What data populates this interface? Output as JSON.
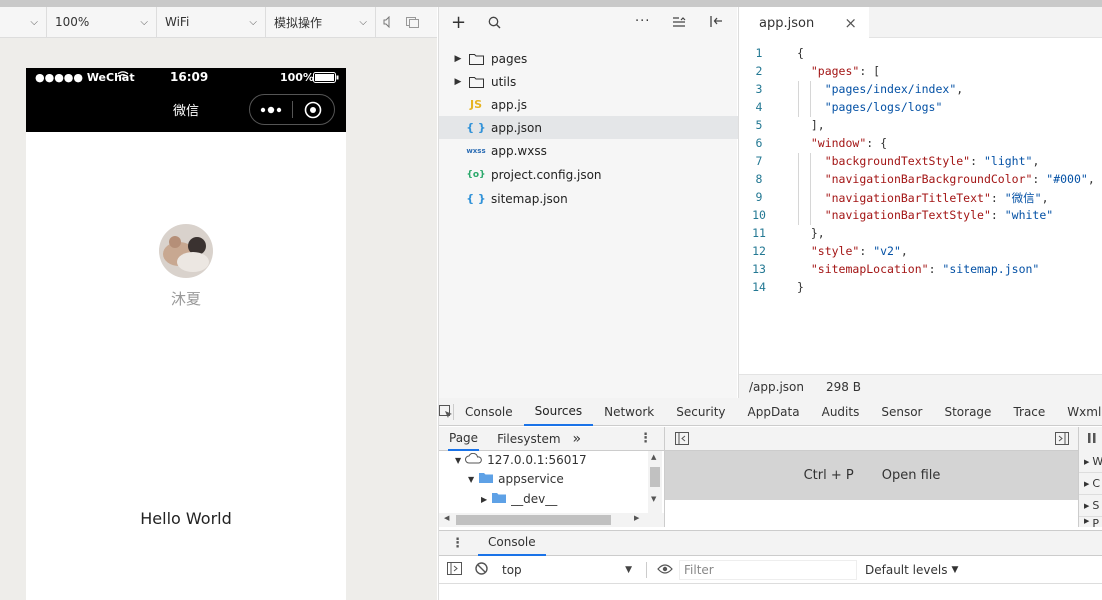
{
  "simulator_toolbar": {
    "device_value": "",
    "zoom_value": "100%",
    "network_value": "WiFi",
    "mode_value": "模拟操作"
  },
  "phone": {
    "status": {
      "carrier": "●●●●● WeChat",
      "time": "16:09",
      "battery": "100%"
    },
    "nav_title": "微信",
    "nickname": "沐夏",
    "hello": "Hello World"
  },
  "explorer": {
    "items": [
      {
        "label": "pages",
        "type": "folder"
      },
      {
        "label": "utils",
        "type": "folder"
      },
      {
        "label": "app.js",
        "type": "js",
        "icon": "JS"
      },
      {
        "label": "app.json",
        "type": "json",
        "icon": "{ }"
      },
      {
        "label": "app.wxss",
        "type": "wxss",
        "icon": "wxss"
      },
      {
        "label": "project.config.json",
        "type": "config",
        "icon": "{o}"
      },
      {
        "label": "sitemap.json",
        "type": "json",
        "icon": "{ }"
      }
    ]
  },
  "editor": {
    "tab_label": "app.json",
    "lines": [
      {
        "n": "1",
        "text": "{"
      },
      {
        "n": "2",
        "text": "  \"pages\": ["
      },
      {
        "n": "3",
        "text": "    \"pages/index/index\","
      },
      {
        "n": "4",
        "text": "    \"pages/logs/logs\""
      },
      {
        "n": "5",
        "text": "  ],"
      },
      {
        "n": "6",
        "text": "  \"window\": {"
      },
      {
        "n": "7",
        "text": "    \"backgroundTextStyle\": \"light\","
      },
      {
        "n": "8",
        "text": "    \"navigationBarBackgroundColor\": \"#000\","
      },
      {
        "n": "9",
        "text": "    \"navigationBarTitleText\": \"微信\","
      },
      {
        "n": "10",
        "text": "    \"navigationBarTextStyle\": \"white\""
      },
      {
        "n": "11",
        "text": "  },"
      },
      {
        "n": "12",
        "text": "  \"style\": \"v2\","
      },
      {
        "n": "13",
        "text": "  \"sitemapLocation\": \"sitemap.json\""
      },
      {
        "n": "14",
        "text": "}"
      }
    ],
    "status_path": "/app.json",
    "status_size": "298 B"
  },
  "devtools": {
    "tabs": [
      "Console",
      "Sources",
      "Network",
      "Security",
      "AppData",
      "Audits",
      "Sensor",
      "Storage",
      "Trace",
      "Wxml"
    ],
    "active_tab": "Sources",
    "sources": {
      "subtabs": [
        "Page",
        "Filesystem"
      ],
      "more": "»",
      "tree": [
        {
          "label": "127.0.0.1:56017",
          "indent": 0
        },
        {
          "label": "appservice",
          "indent": 1
        },
        {
          "label": "__dev__",
          "indent": 2
        }
      ],
      "shortcut": "Ctrl + P",
      "shortcut_action": "Open file",
      "right_letters": [
        "W",
        "C",
        "S",
        "P"
      ]
    },
    "drawer_tab": "Console",
    "console": {
      "context": "top",
      "filter_placeholder": "Filter",
      "levels": "Default levels"
    }
  },
  "colors": {
    "accent": "#1a73e8",
    "folder_blue": "#5ea1e6",
    "json_icon": "#2f91d8",
    "js_icon": "#e6b422"
  }
}
